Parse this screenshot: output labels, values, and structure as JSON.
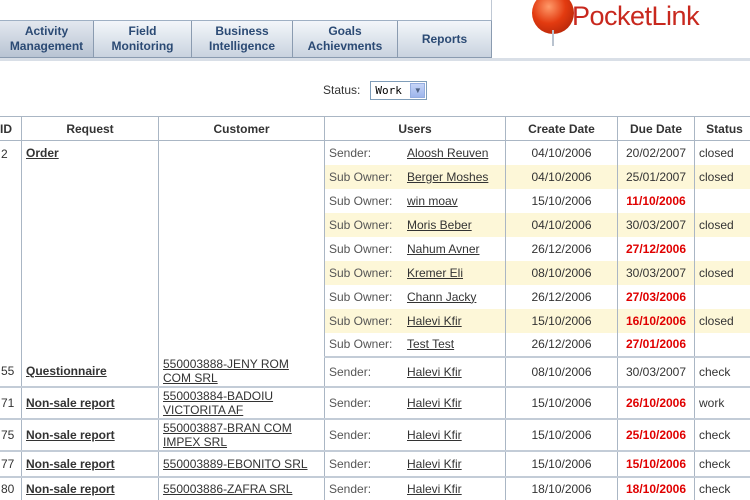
{
  "nav": {
    "tabs": [
      {
        "label": "Activity\nManagement",
        "active": true
      },
      {
        "label": "Field\nMonitoring",
        "active": false
      },
      {
        "label": "Business\nIntelligence",
        "active": false
      },
      {
        "label": "Goals\nAchievments",
        "active": false
      },
      {
        "label": "Reports",
        "active": false
      }
    ]
  },
  "logo": {
    "text": "PocketLink"
  },
  "filter": {
    "label": "Status:",
    "value": "Work"
  },
  "table": {
    "headers": [
      "ID",
      "Request",
      "Customer",
      "Users",
      "Create Date",
      "Due Date",
      "Status"
    ],
    "rows": [
      {
        "id": "2",
        "request": "Order",
        "customer": "",
        "role": "Sender:",
        "user": "Aloosh Reuven",
        "create": "04/10/2006",
        "due": "20/02/2007",
        "late": false,
        "status": "closed",
        "hl": false
      },
      {
        "id": "",
        "request": "",
        "customer": "",
        "role": "Sub Owner:",
        "user": "Berger Moshes",
        "create": "04/10/2006",
        "due": "25/01/2007",
        "late": false,
        "status": "closed",
        "hl": true
      },
      {
        "id": "",
        "request": "",
        "customer": "",
        "role": "Sub Owner:",
        "user": "win moav",
        "create": "15/10/2006",
        "due": "11/10/2006",
        "late": true,
        "status": "",
        "hl": false
      },
      {
        "id": "",
        "request": "",
        "customer": "",
        "role": "Sub Owner:",
        "user": "Moris Beber",
        "create": "04/10/2006",
        "due": "30/03/2007",
        "late": false,
        "status": "closed",
        "hl": true
      },
      {
        "id": "",
        "request": "",
        "customer": "",
        "role": "Sub Owner:",
        "user": "Nahum Avner",
        "create": "26/12/2006",
        "due": "27/12/2006",
        "late": true,
        "status": "",
        "hl": false
      },
      {
        "id": "",
        "request": "",
        "customer": "",
        "role": "Sub Owner:",
        "user": "Kremer Eli",
        "create": "08/10/2006",
        "due": "30/03/2007",
        "late": false,
        "status": "closed",
        "hl": true
      },
      {
        "id": "",
        "request": "",
        "customer": "",
        "role": "Sub Owner:",
        "user": "Chann Jacky",
        "create": "26/12/2006",
        "due": "27/03/2006",
        "late": true,
        "status": "",
        "hl": false
      },
      {
        "id": "",
        "request": "",
        "customer": "",
        "role": "Sub Owner:",
        "user": "Halevi Kfir",
        "create": "15/10/2006",
        "due": "16/10/2006",
        "late": true,
        "status": "closed",
        "hl": true
      },
      {
        "id": "",
        "request": "",
        "customer": "",
        "role": "Sub Owner:",
        "user": "Test Test",
        "create": "26/12/2006",
        "due": "27/01/2006",
        "late": true,
        "status": "",
        "hl": false
      },
      {
        "id": "55",
        "request": "Questionnaire",
        "customer": "550003888-JENY ROM COM SRL",
        "role": "Sender:",
        "user": "Halevi Kfir",
        "create": "08/10/2006",
        "due": "30/03/2007",
        "late": false,
        "status": "check",
        "hl": false
      },
      {
        "id": "71",
        "request": "Non-sale report",
        "customer": "550003884-BADOIU VICTORITA AF",
        "role": "Sender:",
        "user": "Halevi Kfir",
        "create": "15/10/2006",
        "due": "26/10/2006",
        "late": true,
        "status": "work",
        "hl": false
      },
      {
        "id": "75",
        "request": "Non-sale report",
        "customer": "550003887-BRAN COM IMPEX SRL",
        "role": "Sender:",
        "user": "Halevi Kfir",
        "create": "15/10/2006",
        "due": "25/10/2006",
        "late": true,
        "status": "check",
        "hl": false
      },
      {
        "id": "77",
        "request": "Non-sale report",
        "customer": "550003889-EBONITO SRL",
        "role": "Sender:",
        "user": "Halevi Kfir",
        "create": "15/10/2006",
        "due": "15/10/2006",
        "late": true,
        "status": "check",
        "hl": false
      },
      {
        "id": "80",
        "request": "Non-sale report",
        "customer": "550003886-ZAFRA SRL",
        "role": "Sender:",
        "user": "Halevi Kfir",
        "create": "18/10/2006",
        "due": "18/10/2006",
        "late": true,
        "status": "check",
        "hl": false
      }
    ]
  }
}
